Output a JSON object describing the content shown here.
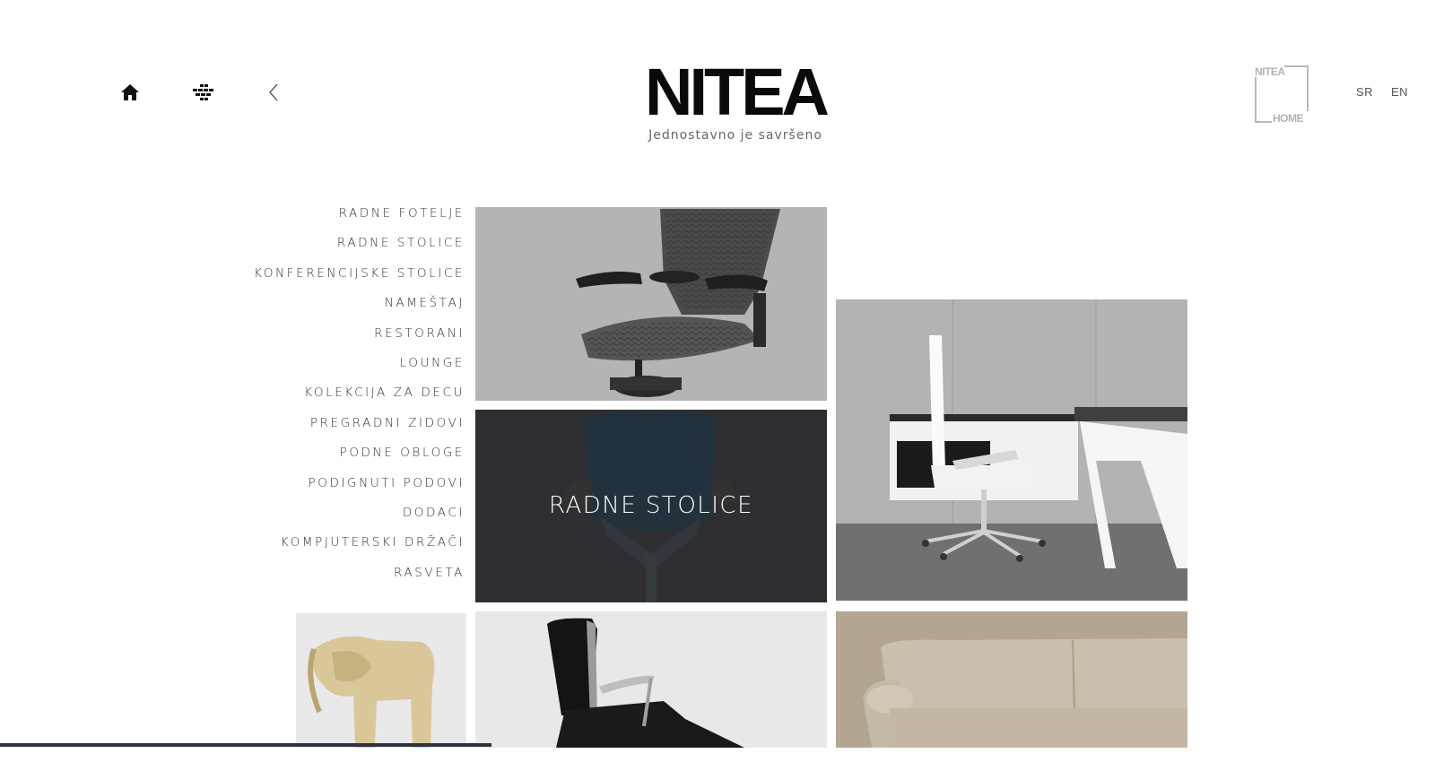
{
  "header": {
    "brand": "NITEA",
    "tagline": "Jednostavno je savršeno",
    "badge_top": "NITEA",
    "badge_bottom": "HOME",
    "icons": [
      "home-icon",
      "grid-icon",
      "chevron-left-icon"
    ],
    "languages": [
      "SR",
      "EN"
    ]
  },
  "menu": {
    "items": [
      "RADNE FOTELJE",
      "RADNE STOLICE",
      "KONFERENCIJSKE STOLICE",
      "NAMEŠTAJ",
      "RESTORANI",
      "LOUNGE",
      "KOLEKCIJA ZA DECU",
      "PREGRADNI ZIDOVI",
      "PODNE OBLOGE",
      "PODIGNUTI PODOVI",
      "DODACI",
      "KOMPJUTERSKI DRŽAČI",
      "RASVETA"
    ]
  },
  "tiles": {
    "featured_label": "RADNE STOLICE"
  },
  "colors": {
    "accent_dark": "#2f2e33",
    "tile_grey": "#b5b5b5",
    "text": "#333333"
  }
}
